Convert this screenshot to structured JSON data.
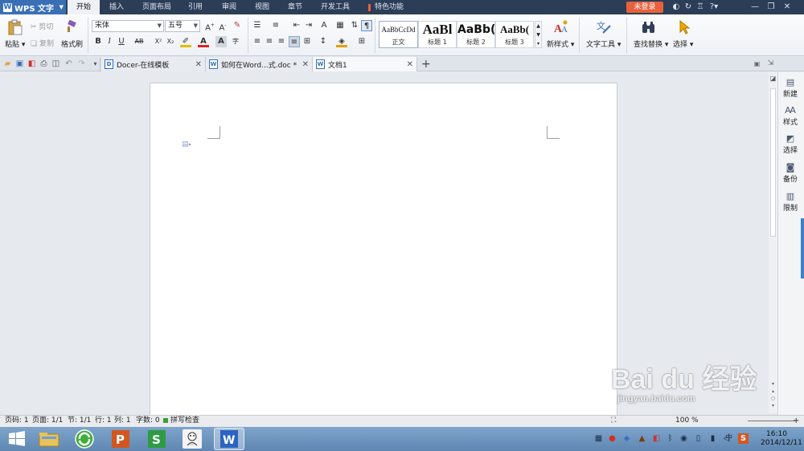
{
  "app": {
    "name": "WPS 文字",
    "login_label": "未登录"
  },
  "menu_tabs": [
    {
      "label": "开始"
    },
    {
      "label": "插入"
    },
    {
      "label": "页面布局"
    },
    {
      "label": "引用"
    },
    {
      "label": "审阅"
    },
    {
      "label": "视图"
    },
    {
      "label": "章节"
    },
    {
      "label": "开发工具"
    },
    {
      "label": "特色功能"
    }
  ],
  "ribbon": {
    "paste": "粘贴",
    "cut": "剪切",
    "copy": "复制",
    "format_painter": "格式刷",
    "font_name": "宋体",
    "font_size": "五号",
    "styles": [
      {
        "sample": "AaBbCcDd",
        "name": "正文"
      },
      {
        "sample": "AaBl",
        "name": "标题 1"
      },
      {
        "sample": "AaBb(",
        "name": "标题 2"
      },
      {
        "sample": "AaBb(",
        "name": "标题 3"
      }
    ],
    "new_style": "新样式",
    "text_tools": "文字工具",
    "find_replace": "查找替换",
    "select": "选择"
  },
  "doc_tabs": [
    {
      "title": "Docer-在线模板",
      "icon": "D"
    },
    {
      "title": "如何在Word...式.doc *",
      "icon": "W"
    },
    {
      "title": "文档1",
      "icon": "W"
    }
  ],
  "side_panel": [
    {
      "label": "新建",
      "icon": "new-doc-icon"
    },
    {
      "label": "样式",
      "icon": "style-icon"
    },
    {
      "label": "选择",
      "icon": "select-icon"
    },
    {
      "label": "备份",
      "icon": "backup-icon"
    },
    {
      "label": "限制",
      "icon": "restrict-icon"
    }
  ],
  "status": {
    "page_num": "页码: 1",
    "pages": "页面: 1/1",
    "section": "节: 1/1",
    "row": "行: 1",
    "col": "列: 1",
    "word_count": "字数: 0",
    "spell_check": "拼写检查",
    "zoom": "100 %"
  },
  "taskbar": {
    "time": "16:10",
    "date": "2014/12/11",
    "ime": "中"
  },
  "watermark": {
    "brand": "Bai du 经验",
    "url": "jingyan.baidu.com"
  }
}
